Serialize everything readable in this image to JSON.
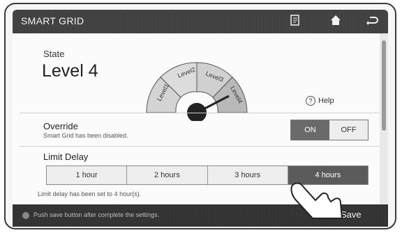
{
  "titlebar": {
    "title": "SMART GRID",
    "icons": [
      "note-icon",
      "home-icon",
      "back-icon"
    ]
  },
  "state": {
    "label": "State",
    "value": "Level 4",
    "gauge_levels": [
      "Level1",
      "Level2",
      "Level3",
      "Level4"
    ],
    "current_level": 4
  },
  "help": {
    "label": "Help"
  },
  "override": {
    "title": "Override",
    "subtitle": "Smart Grid has been disabled.",
    "on_label": "ON",
    "off_label": "OFF",
    "selected": "ON"
  },
  "limit_delay": {
    "title": "Limit Delay",
    "options": [
      "1 hour",
      "2 hours",
      "3 hours",
      "4 hours"
    ],
    "selected": "4 hours",
    "message": "Limit delay has been set to 4 hour(s)."
  },
  "bottombar": {
    "message": "Push save button after complete the settings.",
    "save_label": "Save"
  }
}
